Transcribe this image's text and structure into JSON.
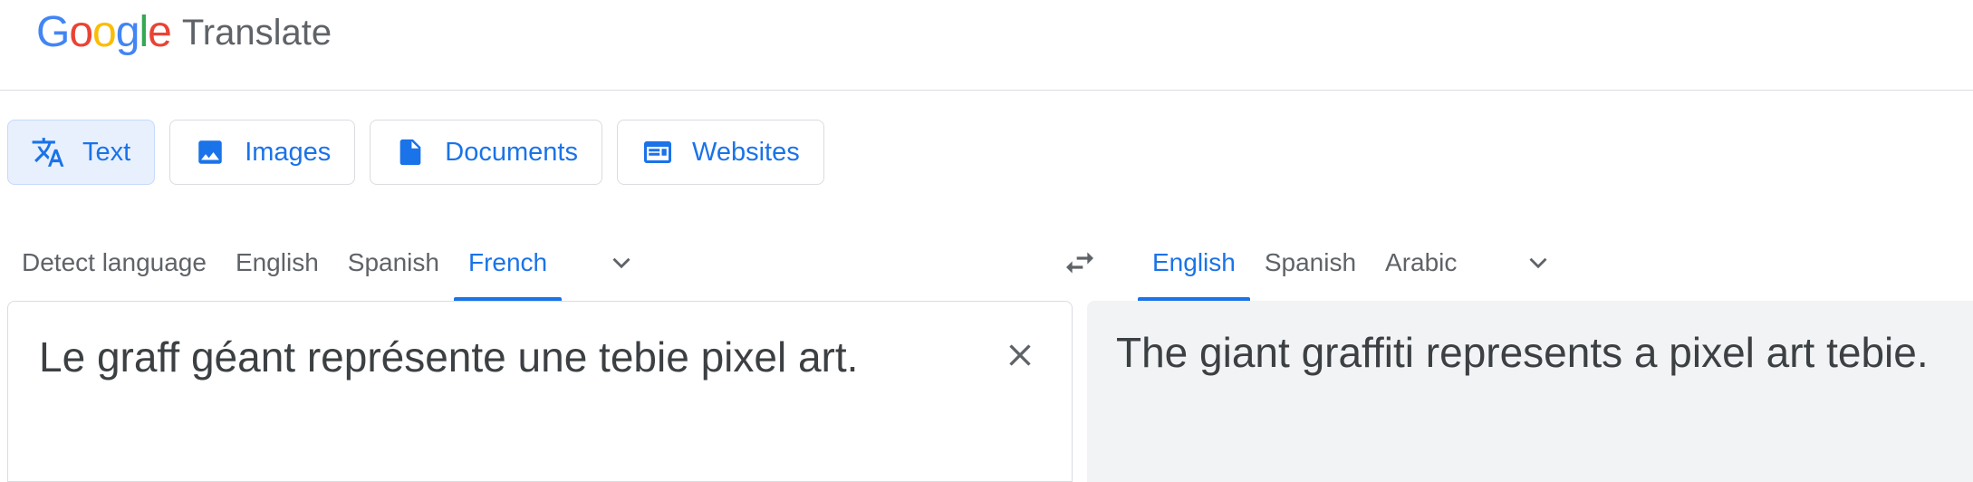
{
  "header": {
    "logo": {
      "letters": [
        "G",
        "o",
        "o",
        "g",
        "l",
        "e"
      ]
    },
    "product_name": "Translate"
  },
  "mode_tabs": [
    {
      "label": "Text",
      "icon": "translate-icon",
      "active": true
    },
    {
      "label": "Images",
      "icon": "image-icon",
      "active": false
    },
    {
      "label": "Documents",
      "icon": "document-icon",
      "active": false
    },
    {
      "label": "Websites",
      "icon": "website-icon",
      "active": false
    }
  ],
  "source_languages": {
    "options": [
      "Detect language",
      "English",
      "Spanish",
      "French"
    ],
    "selected": "French"
  },
  "target_languages": {
    "options": [
      "English",
      "Spanish",
      "Arabic"
    ],
    "selected": "English"
  },
  "source": {
    "text": "Le graff géant représente une tebie pixel art."
  },
  "target": {
    "text": "The giant graffiti represents a pixel art tebie."
  },
  "colors": {
    "accent": "#1a73e8",
    "active_tab_bg": "#e8f0fe",
    "target_panel_bg": "#f1f3f4",
    "text": "#3c4043",
    "muted": "#5f6368"
  }
}
